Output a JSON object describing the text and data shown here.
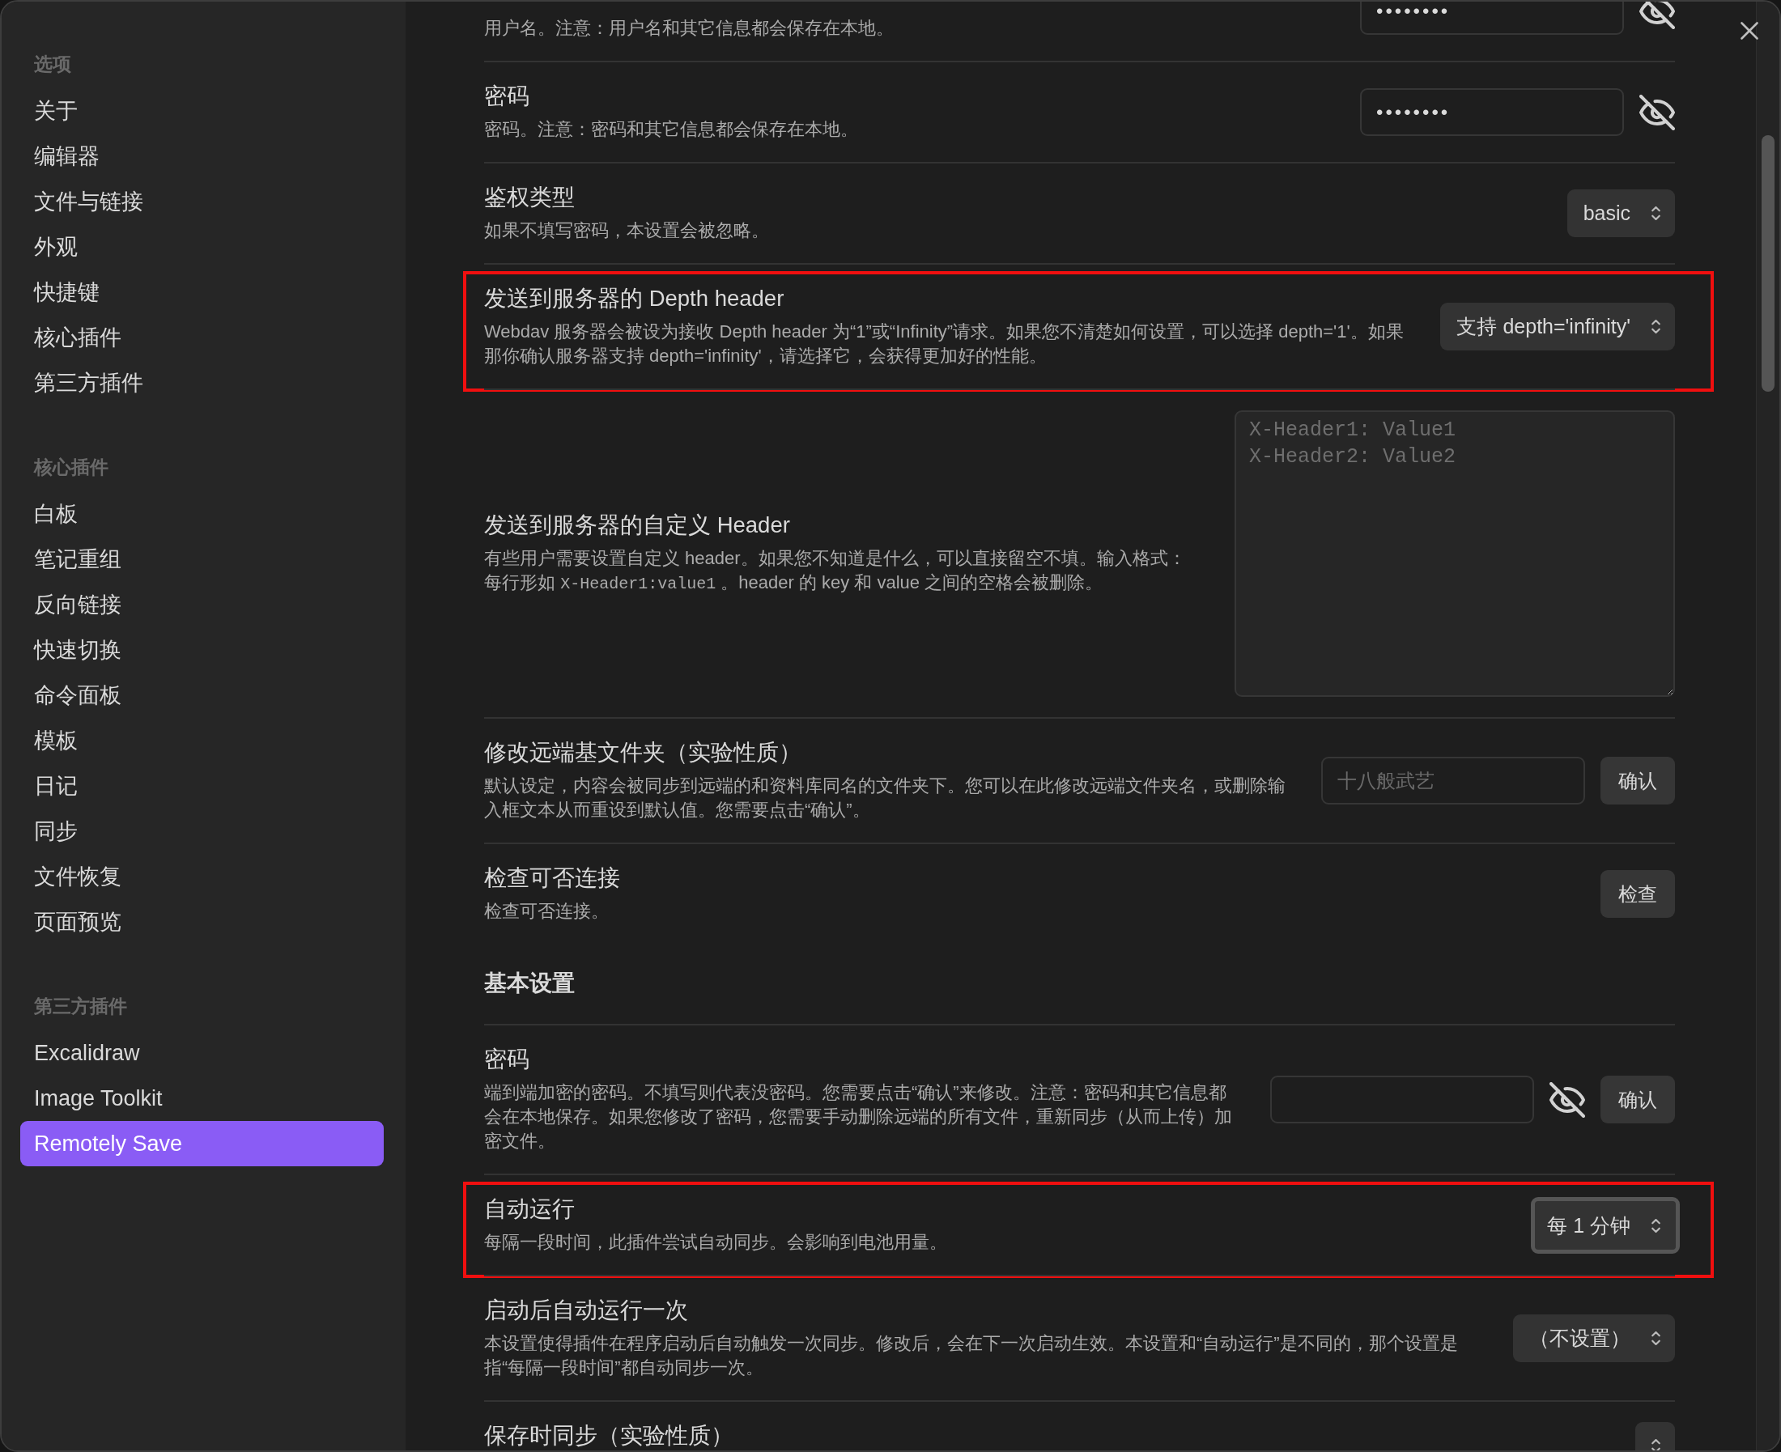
{
  "sidebar": {
    "groups": [
      {
        "heading": "选项",
        "items": [
          {
            "label": "关于",
            "selected": false
          },
          {
            "label": "编辑器",
            "selected": false
          },
          {
            "label": "文件与链接",
            "selected": false
          },
          {
            "label": "外观",
            "selected": false
          },
          {
            "label": "快捷键",
            "selected": false
          },
          {
            "label": "核心插件",
            "selected": false
          },
          {
            "label": "第三方插件",
            "selected": false
          }
        ]
      },
      {
        "heading": "核心插件",
        "items": [
          {
            "label": "白板",
            "selected": false
          },
          {
            "label": "笔记重组",
            "selected": false
          },
          {
            "label": "反向链接",
            "selected": false
          },
          {
            "label": "快速切换",
            "selected": false
          },
          {
            "label": "命令面板",
            "selected": false
          },
          {
            "label": "模板",
            "selected": false
          },
          {
            "label": "日记",
            "selected": false
          },
          {
            "label": "同步",
            "selected": false
          },
          {
            "label": "文件恢复",
            "selected": false
          },
          {
            "label": "页面预览",
            "selected": false
          }
        ]
      },
      {
        "heading": "第三方插件",
        "items": [
          {
            "label": "Excalidraw",
            "selected": false
          },
          {
            "label": "Image Toolkit",
            "selected": false
          },
          {
            "label": "Remotely Save",
            "selected": true
          }
        ]
      }
    ]
  },
  "settings": {
    "rows": [
      {
        "kind": "setting",
        "description": "用户名。注意：用户名和其它信息都会保存在本地。",
        "highlighted": false,
        "controls": [
          {
            "kind": "password",
            "value": "••••••••"
          },
          {
            "kind": "reveal"
          }
        ]
      },
      {
        "kind": "setting",
        "title": "密码",
        "description": "密码。注意：密码和其它信息都会保存在本地。",
        "highlighted": false,
        "controls": [
          {
            "kind": "password",
            "value": "••••••••"
          },
          {
            "kind": "reveal"
          }
        ]
      },
      {
        "kind": "setting",
        "title": "鉴权类型",
        "description": "如果不填写密码，本设置会被忽略。",
        "highlighted": false,
        "controls": [
          {
            "kind": "select",
            "value": "basic",
            "focused": false
          }
        ]
      },
      {
        "kind": "setting",
        "title": "发送到服务器的 Depth header",
        "description": "Webdav 服务器会被设为接收 Depth header 为“1”或“Infinity”请求。如果您不清楚如何设置，可以选择 depth='1'。如果那你确认服务器支持 depth='infinity'，请选择它，会获得更加好的性能。",
        "highlighted": true,
        "controls": [
          {
            "kind": "select",
            "value": "支持 depth='infinity'",
            "focused": false
          }
        ]
      },
      {
        "kind": "setting",
        "title": "发送到服务器的自定义 Header",
        "description_parts": [
          {
            "kind": "text",
            "text": "有些用户需要设置自定义 header。如果您不知道是什么，可以直接留空不填。输入格式：每行形如 "
          },
          {
            "kind": "code",
            "text": "X-Header1:value1"
          },
          {
            "kind": "text",
            "text": " 。header 的 key 和 value 之间的空格会被删除。"
          }
        ],
        "highlighted": false,
        "controls": [
          {
            "kind": "textarea",
            "placeholder": "X-Header1: Value1\nX-Header2: Value2"
          }
        ]
      },
      {
        "kind": "setting",
        "title": "修改远端基文件夹（实验性质）",
        "description": "默认设定，内容会被同步到远端的和资料库同名的文件夹下。您可以在此修改远端文件夹名，或删除输入框文本从而重设到默认值。您需要点击“确认”。",
        "highlighted": false,
        "controls": [
          {
            "kind": "text",
            "placeholder": "十八般武艺"
          },
          {
            "kind": "button",
            "label": "确认"
          }
        ]
      },
      {
        "kind": "setting",
        "title": "检查可否连接",
        "description": "检查可否连接。",
        "highlighted": false,
        "controls": [
          {
            "kind": "button",
            "label": "检查"
          }
        ]
      },
      {
        "kind": "heading",
        "title": "基本设置",
        "highlighted": false
      },
      {
        "kind": "setting",
        "title": "密码",
        "description": "端到端加密的密码。不填写则代表没密码。您需要点击“确认”来修改。注意：密码和其它信息都会在本地保存。如果您修改了密码，您需要手动删除远端的所有文件，重新同步（从而上传）加密文件。",
        "highlighted": false,
        "controls": [
          {
            "kind": "password"
          },
          {
            "kind": "reveal"
          },
          {
            "kind": "button",
            "label": "确认"
          }
        ]
      },
      {
        "kind": "setting",
        "title": "自动运行",
        "description": "每隔一段时间，此插件尝试自动同步。会影响到电池用量。",
        "highlighted": true,
        "controls": [
          {
            "kind": "select",
            "value": "每 1 分钟",
            "focused": true
          }
        ]
      },
      {
        "kind": "setting",
        "title": "启动后自动运行一次",
        "description": "本设置使得插件在程序启动后自动触发一次同步。修改后，会在下一次启动生效。本设置和“自动运行”是不同的，那个设置是指“每隔一段时间”都自动同步一次。",
        "highlighted": false,
        "controls": [
          {
            "kind": "select",
            "value": "（不设置）",
            "focused": false
          }
        ]
      },
      {
        "kind": "setting",
        "title": "保存时同步（实验性质）",
        "highlighted": false,
        "controls": [
          {
            "kind": "select",
            "focused": false
          }
        ]
      }
    ]
  }
}
